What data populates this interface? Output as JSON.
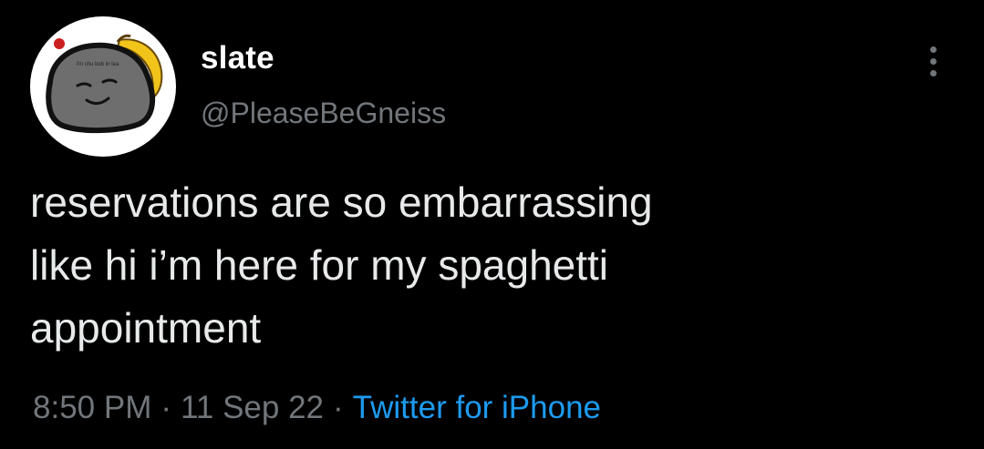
{
  "tweet": {
    "author": {
      "display_name": "slate",
      "handle": "@PleaseBeGneiss",
      "avatar_icon": "cartoon-rock-avatar",
      "avatar_caption": "i'm chu bob in tea"
    },
    "text": "reservations are so embarrassing\nlike hi i’m here for my spaghetti\nappointment",
    "meta": {
      "time": "8:50 PM",
      "date": "11 Sep 22",
      "separator": "·",
      "source": "Twitter for iPhone"
    },
    "more_icon": "more-options-icon"
  },
  "colors": {
    "background": "#000000",
    "text": "#e7e9ea",
    "secondary": "#71767b",
    "link": "#1d9bf0"
  }
}
